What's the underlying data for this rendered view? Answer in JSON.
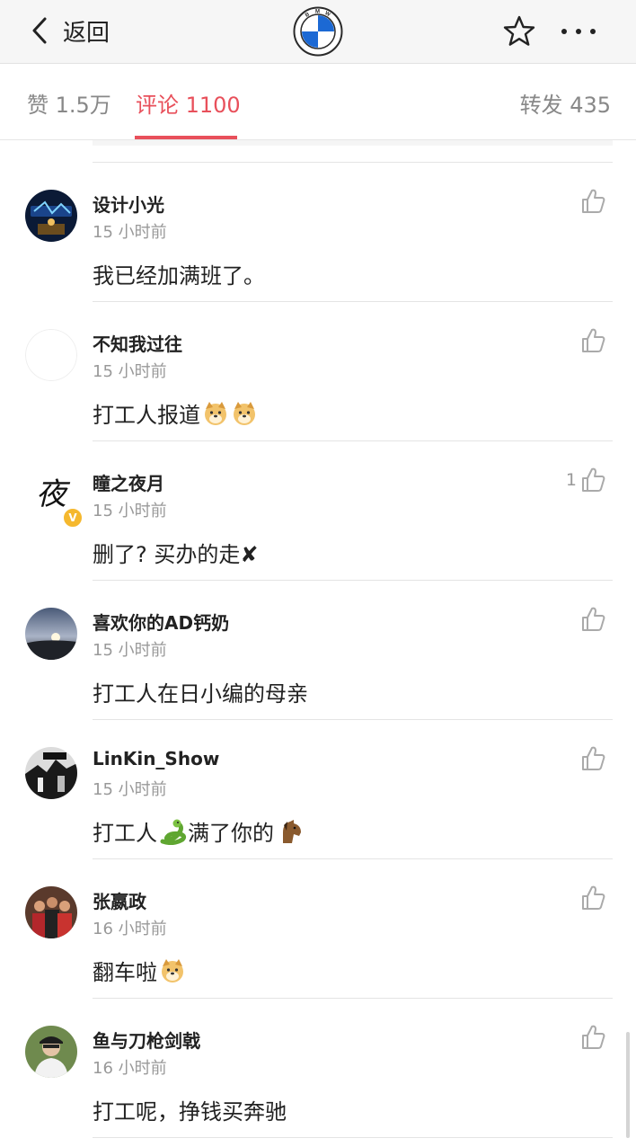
{
  "nav": {
    "back_label": "返回",
    "logo_letters": [
      "B",
      "M",
      "W"
    ]
  },
  "tabs": {
    "likes": "赞 1.5万",
    "comments": "评论 1100",
    "reposts": "转发 435"
  },
  "comments": [
    {
      "user": "设计小光",
      "time": "15 小时前",
      "text": "我已经加满班了。",
      "likes": ""
    },
    {
      "user": "不知我过往",
      "time": "15 小时前",
      "text": "打工人报道",
      "emojis": [
        "doge-emoji",
        "doge-emoji"
      ],
      "likes": ""
    },
    {
      "user": "瞳之夜月",
      "time": "15 小时前",
      "text": "删了? 买办的走✘",
      "likes": "1",
      "avatar_glyph": "夜",
      "verified_mark": "V"
    },
    {
      "user": "喜欢你的AD钙奶",
      "time": "15 小时前",
      "text": "打工人在日小编的母亲",
      "likes": ""
    },
    {
      "user": "LinKin_Show",
      "time": "15 小时前",
      "text_before": "打工人",
      "text_after": "满了你的",
      "emojis": [
        "snake-emoji",
        "horse-emoji"
      ],
      "likes": ""
    },
    {
      "user": "张嬴政",
      "time": "16 小时前",
      "text": "翻车啦",
      "emojis": [
        "doge-emoji"
      ],
      "likes": ""
    },
    {
      "user": "鱼与刀枪剑戟",
      "time": "16 小时前",
      "text": "打工呢，挣钱买奔驰",
      "likes": ""
    }
  ],
  "colors": {
    "accent": "#e8505b",
    "bmw_blue": "#1c69d4",
    "verified": "#f5b82e"
  }
}
